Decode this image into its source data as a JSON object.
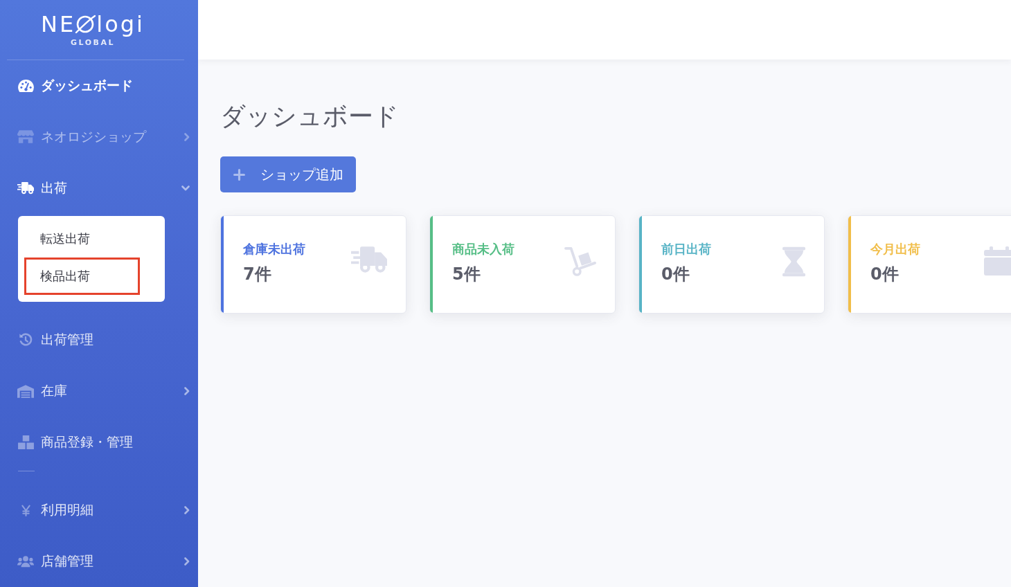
{
  "sidebar": {
    "logo": {
      "wordmark_start": "NE",
      "wordmark_end": "logi",
      "tagline": "GLOBAL"
    },
    "sections": [
      {
        "items": [
          {
            "label": "ダッシュボード",
            "kind": "link",
            "selected": true,
            "expanded": false,
            "disabled": false
          },
          {
            "label": "ネオロジショップ",
            "kind": "group",
            "selected": false,
            "expanded": false,
            "disabled": true
          },
          {
            "label": "出荷",
            "kind": "group",
            "selected": false,
            "expanded": true,
            "disabled": false,
            "children": [
              {
                "label": "転送出荷",
                "highlighted": false
              },
              {
                "label": "検品出荷",
                "highlighted": true
              }
            ]
          },
          {
            "label": "出荷管理",
            "kind": "link",
            "selected": false,
            "expanded": false,
            "disabled": false
          },
          {
            "label": "在庫",
            "kind": "group",
            "selected": false,
            "expanded": false,
            "disabled": false
          },
          {
            "label": "商品登録・管理",
            "kind": "link",
            "selected": false,
            "expanded": false,
            "disabled": false
          }
        ]
      },
      {
        "items": [
          {
            "label": "利用明細",
            "kind": "group",
            "selected": false,
            "expanded": false,
            "disabled": false
          },
          {
            "label": "店舗管理",
            "kind": "group",
            "selected": false,
            "expanded": false,
            "disabled": false
          }
        ]
      }
    ]
  },
  "page": {
    "title": "ダッシュボード",
    "add_button": "ショップ追加"
  },
  "cards": [
    {
      "title": "倉庫未出荷",
      "value": "7件",
      "color": "#4e73df"
    },
    {
      "title": "商品未入荷",
      "value": "5件",
      "color": "#56be86"
    },
    {
      "title": "前日出荷",
      "value": "0件",
      "color": "#58b4c6"
    },
    {
      "title": "今月出荷",
      "value": "0件",
      "color": "#f1be4a"
    }
  ]
}
